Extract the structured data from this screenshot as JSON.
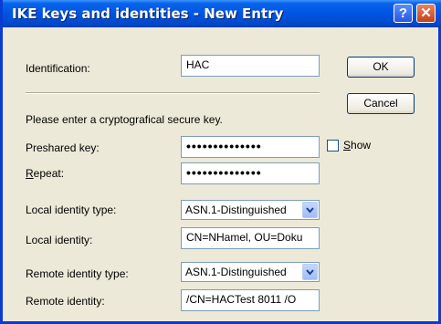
{
  "window": {
    "title": "IKE keys and identities - New Entry",
    "help_glyph": "?",
    "close_glyph": "✕"
  },
  "form": {
    "identification_label": "Identification:",
    "identification_value": "HAC",
    "instruction": "Please enter a cryptografical secure key.",
    "preshared_label": "Preshared key:",
    "preshared_value": "••••••••••••••",
    "repeat_label_rest": "epeat:",
    "repeat_label_mnemonic": "R",
    "repeat_value": "••••••••••••••",
    "show_label_mnemonic": "S",
    "show_label_rest": "how",
    "local_identity_type_label": "Local identity type:",
    "local_identity_type_value": "ASN.1-Distinguished",
    "local_identity_label": "Local identity:",
    "local_identity_value": "CN=NHamel, OU=Doku",
    "remote_identity_type_label": "Remote identity type:",
    "remote_identity_type_value": "ASN.1-Distinguished",
    "remote_identity_label": "Remote identity:",
    "remote_identity_value": "/CN=HACTest 8011 /O"
  },
  "buttons": {
    "ok": "OK",
    "cancel": "Cancel"
  },
  "colors": {
    "titlebar": "#0054e3",
    "face": "#ece9d8",
    "field_border": "#7f9db9"
  }
}
